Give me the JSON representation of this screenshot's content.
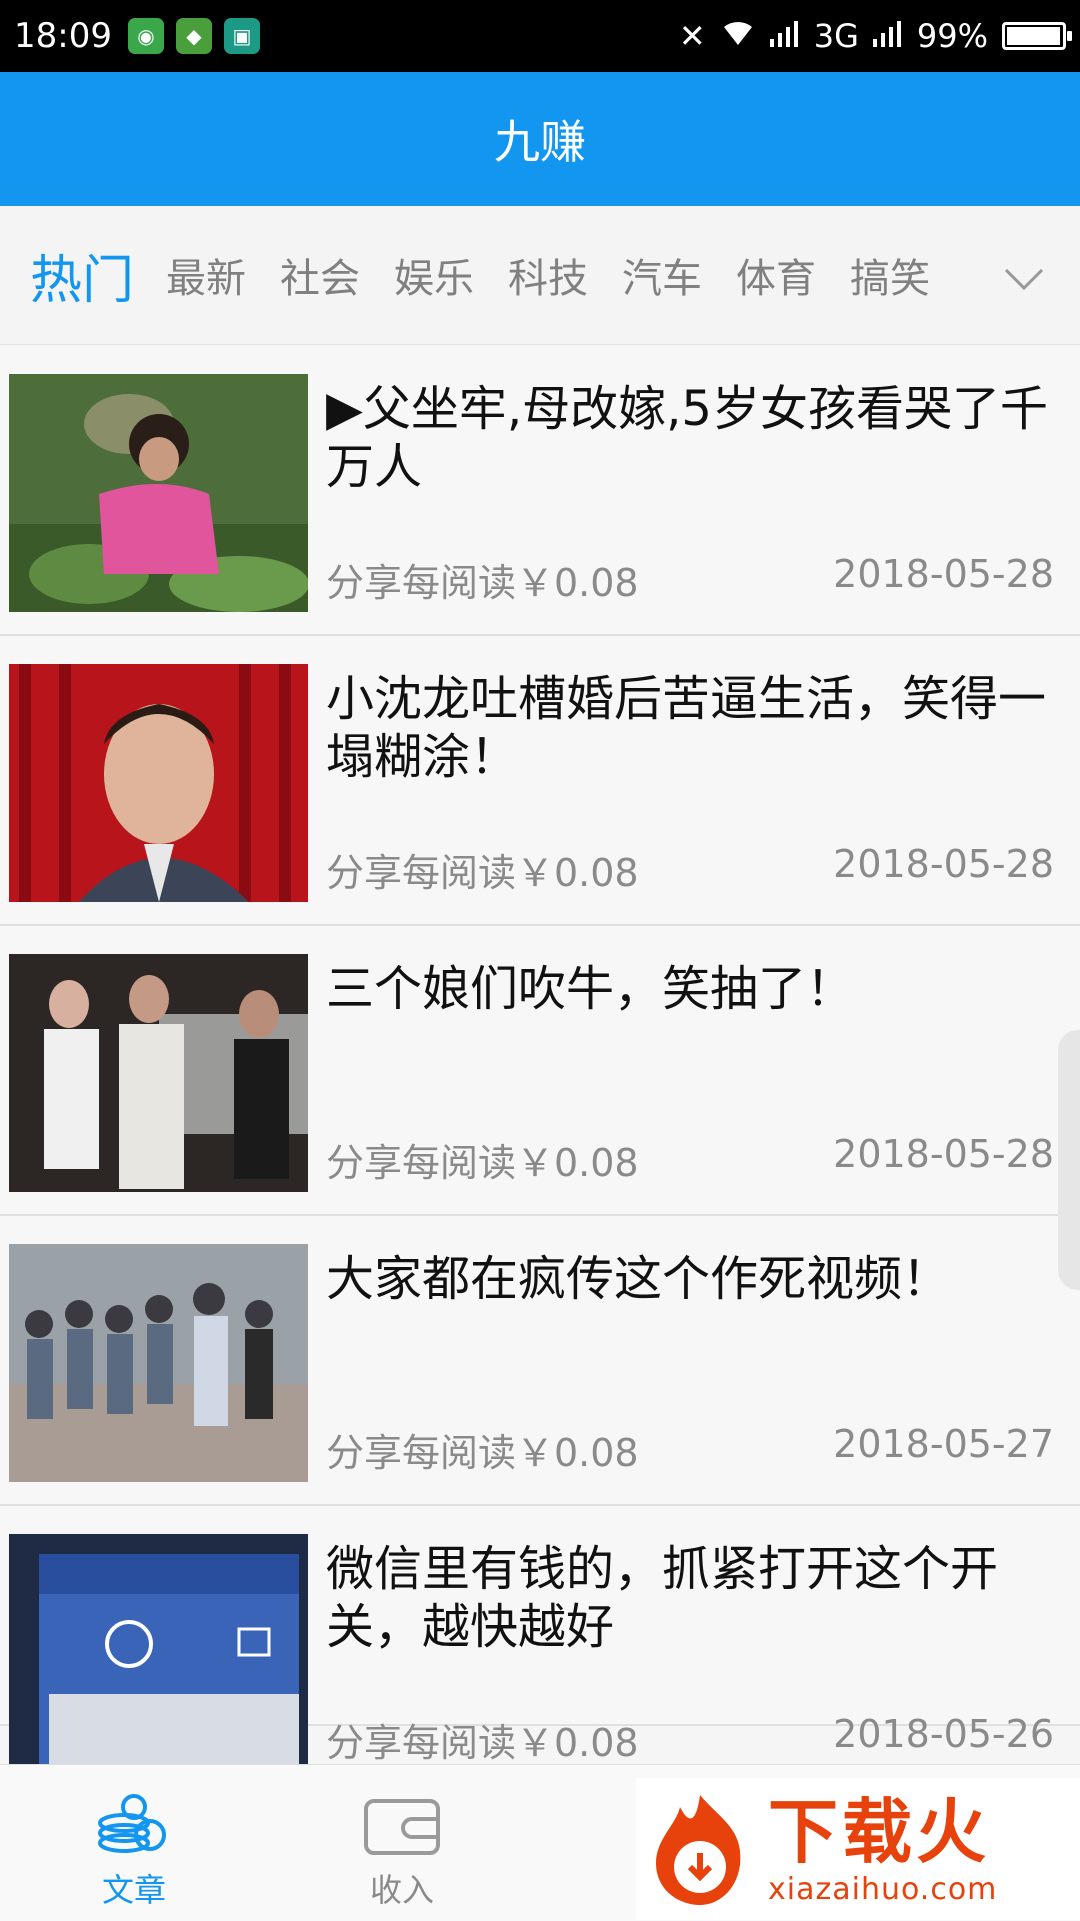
{
  "status_bar": {
    "time": "18:09",
    "network": "3G",
    "battery_percent": "99%",
    "battery_level": 0.99
  },
  "header": {
    "title": "九赚"
  },
  "tabs": [
    {
      "label": "热门",
      "active": true
    },
    {
      "label": "最新"
    },
    {
      "label": "社会"
    },
    {
      "label": "娱乐"
    },
    {
      "label": "科技"
    },
    {
      "label": "汽车"
    },
    {
      "label": "体育"
    },
    {
      "label": "搞笑"
    }
  ],
  "articles": [
    {
      "title": "▶父坐牢,母改嫁,5岁女孩看哭了千万人",
      "reward": "分享每阅读￥0.08",
      "date": "2018-05-28",
      "thumb_icon": "girl-in-field-photo"
    },
    {
      "title": "小沈龙吐槽婚后苦逼生活，笑得一塌糊涂！",
      "reward": "分享每阅读￥0.08",
      "date": "2018-05-28",
      "thumb_icon": "comedian-stage-photo"
    },
    {
      "title": "三个娘们吹牛，笑抽了！",
      "reward": "分享每阅读￥0.08",
      "date": "2018-05-28",
      "thumb_icon": "women-street-photo"
    },
    {
      "title": "大家都在疯传这个作死视频！",
      "reward": "分享每阅读￥0.08",
      "date": "2018-05-27",
      "thumb_icon": "crowd-police-photo"
    },
    {
      "title": "微信里有钱的，抓紧打开这个开关，越快越好",
      "reward": "分享每阅读￥0.08",
      "date": "2018-05-26",
      "thumb_icon": "wechat-wallet-photo"
    }
  ],
  "bottom_nav": [
    {
      "label": "文章",
      "icon": "coins-icon",
      "active": true
    },
    {
      "label": "收入",
      "icon": "wallet-icon"
    }
  ],
  "watermark": {
    "text": "下载火",
    "url": "xiazaihuo.com"
  },
  "colors": {
    "primary": "#1296f0",
    "text": "#111111",
    "meta": "#8a8a8a",
    "watermark": "#e8420c"
  }
}
